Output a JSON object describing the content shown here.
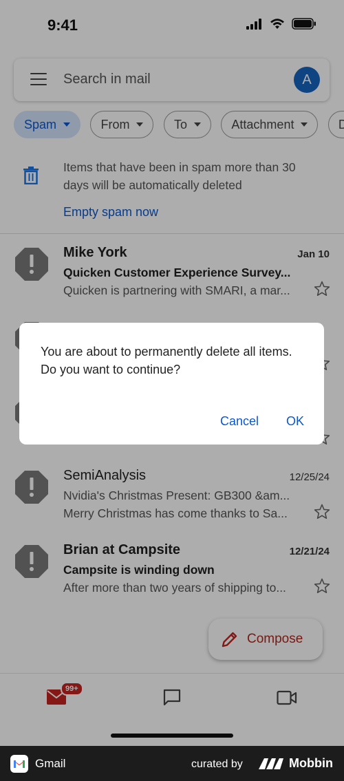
{
  "status_bar": {
    "time": "9:41"
  },
  "search": {
    "placeholder": "Search in mail",
    "avatar_letter": "A"
  },
  "filters": [
    {
      "label": "Spam",
      "active": true
    },
    {
      "label": "From"
    },
    {
      "label": "To"
    },
    {
      "label": "Attachment"
    },
    {
      "label": "Da"
    }
  ],
  "info_banner": {
    "text": "Items that have been in spam more than 30 days will be automatically deleted",
    "action": "Empty spam now"
  },
  "emails": [
    {
      "sender": "Mike York",
      "date": "Jan 10",
      "subject": "Quicken Customer Experience Survey...",
      "snippet": "Quicken is partnering with SMARI, a mar...",
      "unread": true
    },
    {
      "sender": "SemiAnalysis",
      "date": "12/25/24",
      "subject": "Nvidia's Christmas Present: GB300 &am...",
      "snippet": "Merry Christmas has come thanks to Sa...",
      "unread": false
    },
    {
      "sender": "Brian at Campsite",
      "date": "12/21/24",
      "subject": "Campsite is winding down",
      "snippet": "After more than two years of shipping to...",
      "unread": true
    }
  ],
  "compose": {
    "label": "Compose"
  },
  "bottom_nav": {
    "mail_badge": "99+"
  },
  "dialog": {
    "message": "You are about to permanently delete all items. Do you want to continue?",
    "cancel": "Cancel",
    "ok": "OK"
  },
  "footer": {
    "app_name": "Gmail",
    "curated_by": "curated by",
    "brand": "Mobbin"
  },
  "colors": {
    "accent": "#0b57d0",
    "danger": "#c5221f",
    "scrim": "rgba(0,0,0,0.32)"
  }
}
